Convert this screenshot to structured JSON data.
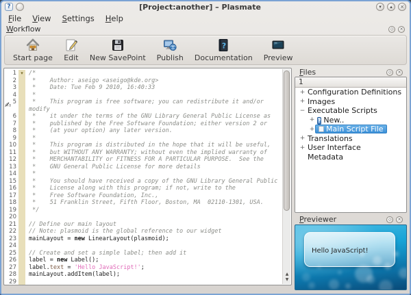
{
  "window": {
    "title": "[Project:another] – Plasmate",
    "titlebar_buttons": {
      "minimize": "▾",
      "maximize": "▴",
      "close": "×",
      "help": "?"
    }
  },
  "menubar": {
    "items": [
      {
        "label": "File",
        "mnemonic": 0
      },
      {
        "label": "View",
        "mnemonic": 0
      },
      {
        "label": "Settings",
        "mnemonic": 0
      },
      {
        "label": "Help",
        "mnemonic": 0
      }
    ]
  },
  "workflow": {
    "title": "Workflow",
    "mnemonic": 0,
    "buttons": [
      {
        "label": "Start page",
        "icon": "home-icon"
      },
      {
        "label": "Edit",
        "icon": "edit-icon"
      },
      {
        "label": "New SavePoint",
        "icon": "savepoint-icon"
      },
      {
        "label": "Publish",
        "icon": "publish-icon"
      },
      {
        "label": "Documentation",
        "icon": "documentation-icon"
      },
      {
        "label": "Preview",
        "icon": "preview-icon"
      }
    ]
  },
  "editor": {
    "fold_marker": "▾",
    "rows": [
      {
        "n": "1",
        "fold": true,
        "segs": [
          {
            "t": "/*",
            "c": "cmt"
          }
        ]
      },
      {
        "n": "2",
        "segs": [
          {
            "t": " *    Author: aseigo <aseigo@kde.org>",
            "c": "cmt"
          }
        ]
      },
      {
        "n": "3",
        "segs": [
          {
            "t": " *    Date: Tue Feb 9 2010, 16:40:33",
            "c": "cmt"
          }
        ]
      },
      {
        "n": "4",
        "segs": [
          {
            "t": " *",
            "c": "cmt"
          }
        ]
      },
      {
        "n": "5",
        "segs": [
          {
            "t": " *    This program is free software; you can redistribute it and/or",
            "c": "cmt"
          }
        ]
      },
      {
        "n": "",
        "segs": [
          {
            "t": "modify",
            "c": "cmt"
          }
        ]
      },
      {
        "n": "6",
        "segs": [
          {
            "t": " *    it under the terms of the GNU Library General Public License as",
            "c": "cmt"
          }
        ]
      },
      {
        "n": "7",
        "segs": [
          {
            "t": " *    published by the Free Software Foundation; either version 2 or",
            "c": "cmt"
          }
        ]
      },
      {
        "n": "8",
        "segs": [
          {
            "t": " *    (at your option) any later version.",
            "c": "cmt"
          }
        ]
      },
      {
        "n": "9",
        "segs": [
          {
            "t": " *",
            "c": "cmt"
          }
        ]
      },
      {
        "n": "10",
        "segs": [
          {
            "t": " *    This program is distributed in the hope that it will be useful,",
            "c": "cmt"
          }
        ]
      },
      {
        "n": "11",
        "segs": [
          {
            "t": " *    but WITHOUT ANY WARRANTY; without even the implied warranty of",
            "c": "cmt"
          }
        ]
      },
      {
        "n": "12",
        "segs": [
          {
            "t": " *    MERCHANTABILITY or FITNESS FOR A PARTICULAR PURPOSE.  See the",
            "c": "cmt"
          }
        ]
      },
      {
        "n": "13",
        "segs": [
          {
            "t": " *    GNU General Public License for more details",
            "c": "cmt"
          }
        ]
      },
      {
        "n": "14",
        "segs": [
          {
            "t": " *",
            "c": "cmt"
          }
        ]
      },
      {
        "n": "15",
        "segs": [
          {
            "t": " *    You should have received a copy of the GNU Library General Public",
            "c": "cmt"
          }
        ]
      },
      {
        "n": "16",
        "segs": [
          {
            "t": " *    License along with this program; if not, write to the",
            "c": "cmt"
          }
        ]
      },
      {
        "n": "17",
        "segs": [
          {
            "t": " *    Free Software Foundation, Inc.,",
            "c": "cmt"
          }
        ]
      },
      {
        "n": "18",
        "segs": [
          {
            "t": " *    51 Franklin Street, Fifth Floor, Boston, MA  02110-1301, USA.",
            "c": "cmt"
          }
        ]
      },
      {
        "n": "19",
        "segs": [
          {
            "t": " */",
            "c": "cmt"
          }
        ]
      },
      {
        "n": "20",
        "segs": []
      },
      {
        "n": "21",
        "segs": [
          {
            "t": "// Define our main layout",
            "c": "cmt"
          }
        ]
      },
      {
        "n": "22",
        "segs": [
          {
            "t": "// Note: plasmoid is the global reference to our widget",
            "c": "cmt"
          }
        ]
      },
      {
        "n": "23",
        "segs": [
          {
            "t": "mainLayout = ",
            "c": "code"
          },
          {
            "t": "new",
            "c": "kw"
          },
          {
            "t": " LinearLayout(plasmoid);",
            "c": "code"
          }
        ]
      },
      {
        "n": "24",
        "segs": []
      },
      {
        "n": "25",
        "segs": [
          {
            "t": "// Create and set a simple label; then add it",
            "c": "cmt"
          }
        ]
      },
      {
        "n": "26",
        "segs": [
          {
            "t": "label = ",
            "c": "code"
          },
          {
            "t": "new",
            "c": "kw"
          },
          {
            "t": " Label();",
            "c": "code"
          }
        ]
      },
      {
        "n": "27",
        "segs": [
          {
            "t": "label.",
            "c": "code"
          },
          {
            "t": "text",
            "c": "prop"
          },
          {
            "t": " = ",
            "c": "code"
          },
          {
            "t": "'Hello JavaScript!'",
            "c": "str"
          },
          {
            "t": ";",
            "c": "code"
          }
        ]
      },
      {
        "n": "28",
        "segs": [
          {
            "t": "mainLayout.addItem(label);",
            "c": "code"
          }
        ]
      },
      {
        "n": "29",
        "segs": []
      }
    ]
  },
  "files": {
    "title": "Files",
    "mnemonic": 0,
    "column_header": "1",
    "items": [
      {
        "label": "Configuration Definitions",
        "expander": "+",
        "depth": 0
      },
      {
        "label": "Images",
        "expander": "+",
        "depth": 0
      },
      {
        "label": "Executable Scripts",
        "expander": "−",
        "depth": 0
      },
      {
        "label": "New..",
        "expander": "+",
        "depth": 1,
        "icon": "help"
      },
      {
        "label": "Main Script File",
        "expander": "+",
        "depth": 1,
        "icon": "script",
        "selected": true
      },
      {
        "label": "Translations",
        "expander": "+",
        "depth": 0
      },
      {
        "label": "User Interface",
        "expander": "+",
        "depth": 0
      },
      {
        "label": "Metadata",
        "expander": "",
        "depth": 0
      }
    ]
  },
  "previewer": {
    "title": "Previewer",
    "mnemonic": 0,
    "widget_text": "Hello JavaScript!"
  },
  "colors": {
    "selection": "#3c90d8",
    "string": "#e06ab8",
    "comment": "#8b8d88",
    "fold_strip": "#e8dfba",
    "preview_top": "#49bce4",
    "preview_bottom": "#0a4a78",
    "window_border": "#7ba3d4"
  }
}
